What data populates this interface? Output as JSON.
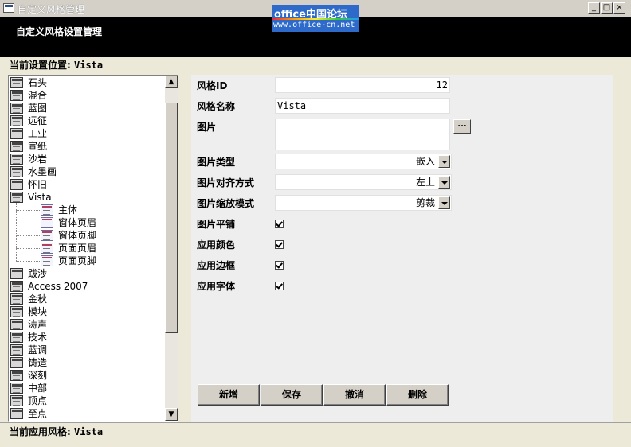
{
  "window": {
    "title": "自定义风格管理",
    "minimize_glyph": "_",
    "maximize_glyph": "□",
    "close_glyph": "×"
  },
  "header": {
    "title": "自定义风格设置管理"
  },
  "watermark": {
    "line1": "office中国论坛",
    "line2": "www.office-cn.net"
  },
  "location": {
    "label": "当前设置位置:",
    "value": "Vista"
  },
  "tree": {
    "top_items": [
      "石头",
      "混合",
      "蓝图",
      "远征",
      "工业",
      "宣纸",
      "沙岩",
      "水墨画",
      "怀旧",
      "Vista"
    ],
    "children": [
      "主体",
      "窗体页眉",
      "窗体页脚",
      "页面页眉",
      "页面页脚"
    ],
    "bottom_items": [
      "跋涉",
      "Access 2007",
      "金秋",
      "模块",
      "涛声",
      "技术",
      "蓝调",
      "铸造",
      "深刻",
      "中部",
      "顶点",
      "至点"
    ]
  },
  "form": {
    "style_id_label": "风格ID",
    "style_id_value": "12",
    "style_name_label": "风格名称",
    "style_name_value": "Vista",
    "picture_label": "图片",
    "picture_value": "",
    "browse_label": "...",
    "picture_type_label": "图片类型",
    "picture_type_value": "嵌入",
    "picture_align_label": "图片对齐方式",
    "picture_align_value": "左上",
    "picture_zoom_label": "图片缩放模式",
    "picture_zoom_value": "剪裁",
    "picture_tile_label": "图片平铺",
    "picture_tile_checked": true,
    "apply_color_label": "应用颜色",
    "apply_color_checked": true,
    "apply_border_label": "应用边框",
    "apply_border_checked": true,
    "apply_font_label": "应用字体",
    "apply_font_checked": true
  },
  "buttons": {
    "new": "新增",
    "save": "保存",
    "undo": "撤消",
    "delete": "删除"
  },
  "status": {
    "label": "当前应用风格:",
    "value": "Vista"
  }
}
